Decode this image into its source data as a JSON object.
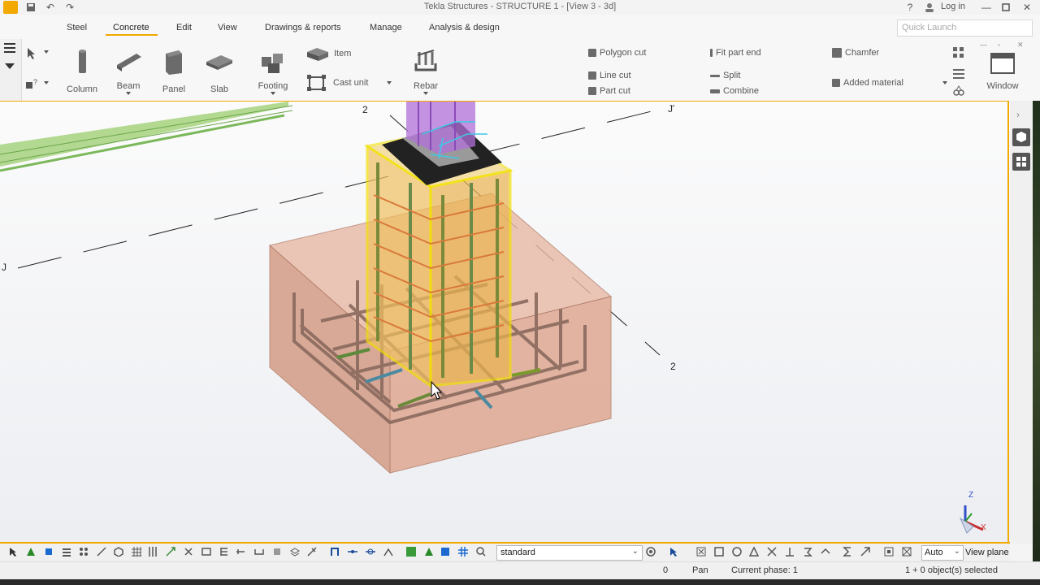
{
  "window": {
    "title": "Tekla Structures - STRUCTURE 1 - [View 3 - 3d]",
    "login": "Log in",
    "help": "?"
  },
  "tabs": [
    "Steel",
    "Concrete",
    "Edit",
    "View",
    "Drawings & reports",
    "Manage",
    "Analysis & design"
  ],
  "quick_launch": {
    "placeholder": "Quick Launch"
  },
  "ribbon": {
    "column": "Column",
    "beam": "Beam",
    "panel": "Panel",
    "slab": "Slab",
    "footing": "Footing",
    "item": "Item",
    "cast_unit": "Cast unit",
    "rebar": "Rebar",
    "polygon_cut": "Polygon cut",
    "line_cut": "Line cut",
    "part_cut": "Part cut",
    "fit_part_end": "Fit part end",
    "split": "Split",
    "combine": "Combine",
    "chamfer": "Chamfer",
    "added_material": "Added material",
    "window": "Window"
  },
  "grid_labels": {
    "top_2": "2",
    "top_j": "J",
    "left_j": "J",
    "right_2": "2"
  },
  "axis": {
    "z": "Z",
    "x": "X"
  },
  "bottom": {
    "filter": "standard",
    "auto": "Auto",
    "view_plane": "View plane"
  },
  "status": {
    "count": "0",
    "mode": "Pan",
    "phase": "Current phase: 1",
    "selected": "1 + 0 object(s) selected"
  },
  "colors": {
    "accent": "#f2a900",
    "footing": "#d9a08a",
    "column": "#e9c25a",
    "rebar": "#9a7060",
    "green_beam": "#8cc66a",
    "purple_column": "#b070d8"
  }
}
